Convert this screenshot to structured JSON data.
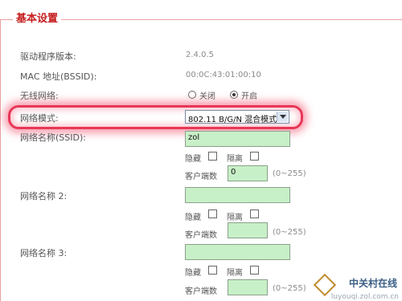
{
  "section": {
    "title": "基本设置"
  },
  "rows": {
    "driver": {
      "label": "驱动程序版本:",
      "value": "2.4.0.5"
    },
    "mac": {
      "label": "MAC 地址(BSSID):",
      "value": "00:0C:43:01:00:10"
    },
    "wireless": {
      "label": "无线网络:",
      "off_label": "关闭",
      "on_label": "开启",
      "selected": "开启"
    },
    "mode": {
      "label": "网络模式:",
      "selected": "802.11 B/G/N 混合模式"
    },
    "ssid1": {
      "label": "网络名称(SSID):",
      "value": "zol",
      "hide_label": "隐藏",
      "isolate_label": "隔离",
      "clients_label": "客户端数",
      "clients_value": "0",
      "range": "(0~255)"
    },
    "ssid2": {
      "label": "网络名称 2:",
      "value": "",
      "hide_label": "隐藏",
      "isolate_label": "隔离",
      "clients_label": "客户端数",
      "clients_value": "",
      "range": "(0~255)"
    },
    "ssid3": {
      "label": "网络名称 3:",
      "value": "",
      "hide_label": "隐藏",
      "isolate_label": "隔离",
      "clients_label": "客户端数",
      "clients_value": "",
      "range": "(0~255)"
    }
  },
  "watermark": {
    "text": "中关村在线",
    "sub": "luyouqi.zol.com.cn"
  },
  "colors": {
    "legend": "#c51c1c",
    "highlight": "#e83656",
    "input_bg": "#c8f0c8"
  }
}
